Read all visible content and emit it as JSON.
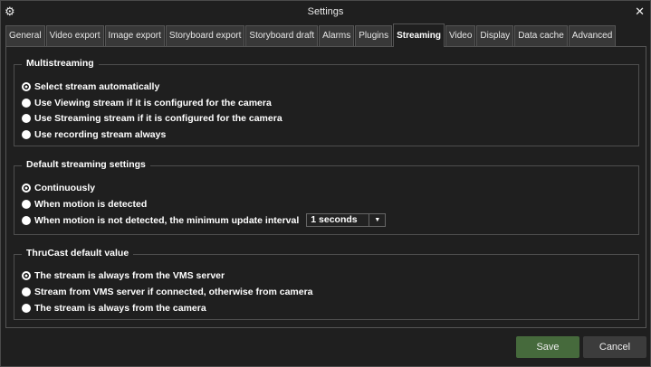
{
  "window": {
    "title": "Settings"
  },
  "tabs": [
    {
      "label": "General"
    },
    {
      "label": "Video export"
    },
    {
      "label": "Image export"
    },
    {
      "label": "Storyboard export"
    },
    {
      "label": "Storyboard draft"
    },
    {
      "label": "Alarms"
    },
    {
      "label": "Plugins"
    },
    {
      "label": "Streaming",
      "selected": true
    },
    {
      "label": "Video"
    },
    {
      "label": "Display"
    },
    {
      "label": "Data cache"
    },
    {
      "label": "Advanced"
    }
  ],
  "groups": [
    {
      "title": "Multistreaming",
      "options": [
        {
          "label": "Select stream automatically",
          "selected": true
        },
        {
          "label": "Use Viewing stream if it is configured for the camera"
        },
        {
          "label": "Use Streaming stream if it is configured for the camera"
        },
        {
          "label": "Use recording stream always"
        }
      ]
    },
    {
      "title": "Default streaming settings",
      "options": [
        {
          "label": "Continuously",
          "selected": true
        },
        {
          "label": "When motion is detected"
        },
        {
          "label": "When motion is not detected, the minimum update interval"
        }
      ],
      "interval": "1 seconds"
    },
    {
      "title": "ThruCast default value",
      "options": [
        {
          "label": "The stream is always from the VMS server",
          "selected": true
        },
        {
          "label": "Stream from VMS server if connected, otherwise from camera"
        },
        {
          "label": "The stream is always from the camera"
        }
      ]
    }
  ],
  "buttons": {
    "save": "Save",
    "cancel": "Cancel"
  },
  "colors": {
    "save": "#466a3c",
    "background": "#1f1f1f"
  }
}
